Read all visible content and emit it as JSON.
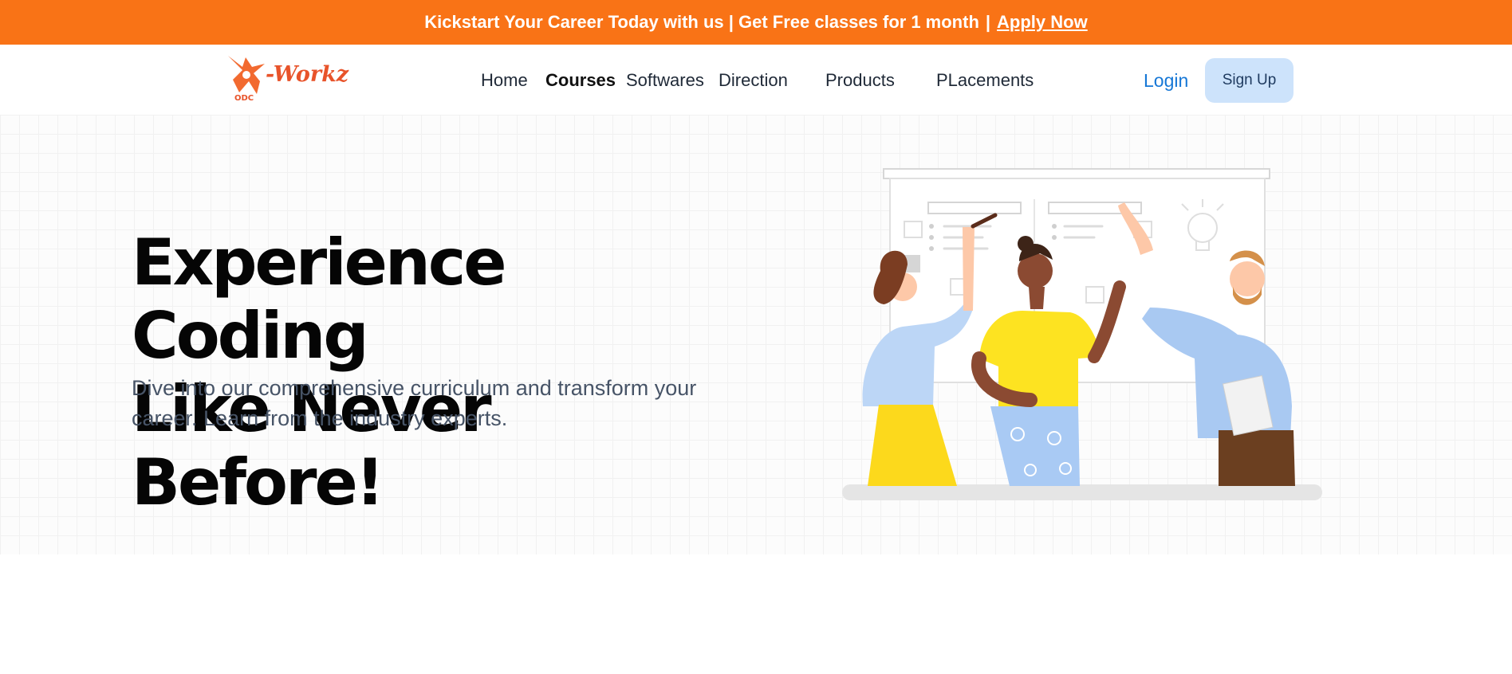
{
  "banner": {
    "text": "Kickstart Your Career Today with us | Get Free classes for",
    "highlight": "1 month",
    "separator": "|",
    "link": "Apply Now",
    "background": "#f97316"
  },
  "logo": {
    "word": "-Workz",
    "sub": "ODC"
  },
  "nav": {
    "items": [
      {
        "label": "Home"
      },
      {
        "label": "Courses"
      },
      {
        "label": "Softwares"
      },
      {
        "label": "Direction"
      },
      {
        "label": "Products"
      },
      {
        "label": "PLacements"
      }
    ],
    "login": "Login",
    "signup": "Sign Up"
  },
  "hero": {
    "headline_part1": "Experience",
    "headline_highlight": "Coding",
    "headline_line2": "Like Never Before!",
    "subtext": "Dive into our comprehensive curriculum and transform your career. Learn from the industry experts.",
    "accent": "#f97316"
  },
  "illustration": {
    "icon": "team-collaboration-illustration"
  }
}
